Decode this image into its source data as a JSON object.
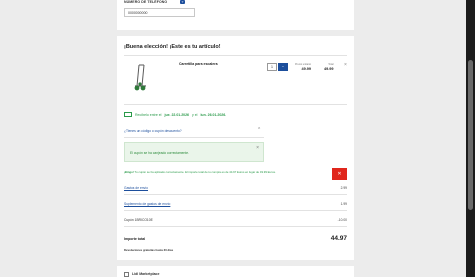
{
  "contact": {
    "phone_label": "NÚMERO DE TELÉFONO",
    "help_icon": "question-icon",
    "phone_value": "0000000000"
  },
  "order": {
    "title": "¡Buena elección! ¡Este es tu artículo!",
    "product": {
      "name": "Carretilla para escalera",
      "quantity": "1",
      "unit_price_label": "Precio unitario",
      "unit_price": "49.99",
      "total_label": "Total",
      "total": "49.99",
      "remove_icon": "close-icon",
      "decrement_icon": "minus-icon"
    },
    "delivery": {
      "prefix": "Recíbelo entre el",
      "date_from": "jue. 22.01.2026",
      "mid": "y el",
      "date_to": "lun. 26.01.2026."
    },
    "coupon": {
      "toggle_label": "¿Tienes un código o cupón descuento?",
      "applied_message": "El cupón se ha canjeado correctamente."
    },
    "promo": {
      "bold": "¡Bingo!",
      "text": "Tu cupón se ha aplicado correctamente. El importe total de tu compra es de 44.97 Euros en lugar de 49.99 Euros."
    },
    "summary": {
      "shipping_label": "Gastos de envío",
      "shipping_value": "2.99",
      "bulky_label": "Suplemento de gastos de envío",
      "bulky_value": "1.99",
      "coupon_label": "Cupón 1BRICO10E",
      "coupon_value": "-10.00",
      "total_label": "Importe total",
      "total_value": "44.97",
      "returns_note": "Devoluciones gratuitas hasta 30 días"
    }
  },
  "next_section": {
    "title": "Lidl Marketplace"
  },
  "colors": {
    "brand_blue": "#1c4e9c",
    "success_green": "#2a9a4a",
    "danger_red": "#e0261c"
  }
}
